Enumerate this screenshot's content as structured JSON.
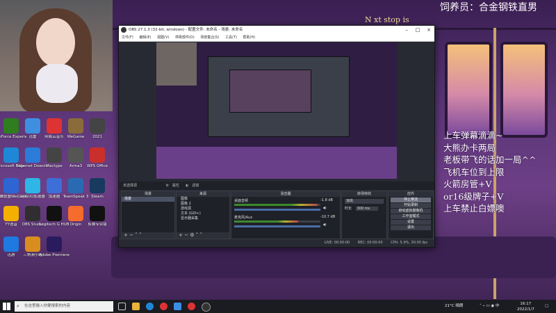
{
  "overlay": {
    "top_right": "饲养员：合金钢铁直男",
    "sign": "N xt stop is",
    "lines": [
      "上车弹幕滴滴~",
      "大熊办卡两局",
      "老板带飞的话加一局^^",
      "飞机车位到上限",
      "火箭房管+V",
      "or16级牌子+V",
      "上车禁止白嫖噢"
    ]
  },
  "desktop_icons": [
    {
      "label": "GeForce Experience",
      "color": "#2f7d1f"
    },
    {
      "label": "迅雷",
      "color": "#3f8fe0"
    },
    {
      "label": "网易云音乐",
      "color": "#d33"
    },
    {
      "label": "WeGame",
      "color": "#8a6c3a"
    },
    {
      "label": "2021",
      "color": "#444"
    },
    {
      "label": "Microsoft Edge",
      "color": "#1f88d6"
    },
    {
      "label": "Internet Download",
      "color": "#2b7bd8"
    },
    {
      "label": "Mactype",
      "color": "#444"
    },
    {
      "label": "Arma3",
      "color": "#555"
    },
    {
      "label": "WPS Office",
      "color": "#c9302c"
    },
    {
      "label": "英雄联盟WeGame版",
      "color": "#2d66d2"
    },
    {
      "label": "网易UU加速器",
      "color": "#2db6e6"
    },
    {
      "label": "加速器",
      "color": "#3e6ed8"
    },
    {
      "label": "TeamSpeak 3",
      "color": "#2a6ab3"
    },
    {
      "label": "Steam",
      "color": "#173a5e"
    },
    {
      "label": "YY语音",
      "color": "#f4b000"
    },
    {
      "label": "OBS Studio",
      "color": "#302e31"
    },
    {
      "label": "Logitech G HUB",
      "color": "#111"
    },
    {
      "label": "Origin",
      "color": "#f56c2d"
    },
    {
      "label": "剪映专业版",
      "color": "#111"
    },
    {
      "label": "迅游",
      "color": "#1e7ae0"
    },
    {
      "label": "三角洲小组",
      "color": "#d98d1e"
    },
    {
      "label": "Adobe Premiere",
      "color": "#2a1a5e"
    }
  ],
  "obs": {
    "title": "OBS 27.1.3 (32-bit, windows) - 配置文件: 未命名 - 场景: 未命名",
    "menu": [
      "文件(F)",
      "编辑(E)",
      "视图(V)",
      "停靠部件(D)",
      "场景集合(S)",
      "工具(T)",
      "帮助(H)"
    ],
    "no_source": "未选择源",
    "mode_props": "属性",
    "mode_filters": "滤镜",
    "panels": {
      "scenes": "场景",
      "sources": "来源",
      "mixer": "混音器",
      "transitions": "转场特效",
      "controls": "控件"
    },
    "scene_items": [
      "场景"
    ],
    "source_items": [
      "图像",
      "图像 2",
      "游戏源",
      "文本 (GDI+)",
      "显示器采集"
    ],
    "mixer": [
      {
        "name": "桌面音频",
        "value": "-1.8 dB"
      },
      {
        "name": "麦克风/Aux",
        "value": "-10.7 dB"
      }
    ],
    "transition": {
      "type": "淡出",
      "duration_label": "时长",
      "duration": "300 ms"
    },
    "controls": [
      "停止推流",
      "开始录制",
      "启动虚拟摄像机",
      "工作室模式",
      "设置",
      "退出"
    ],
    "status": {
      "live": "LIVE: 00:00:00",
      "rec": "REC: 00:00:00",
      "cpu": "CPU: 5.9%, 30.00 fps"
    }
  },
  "taskbar": {
    "search_placeholder": "在这里输入你要搜索的内容",
    "weather": "21°C 晴朗",
    "time": "16:17",
    "date": "2022/1/7"
  }
}
